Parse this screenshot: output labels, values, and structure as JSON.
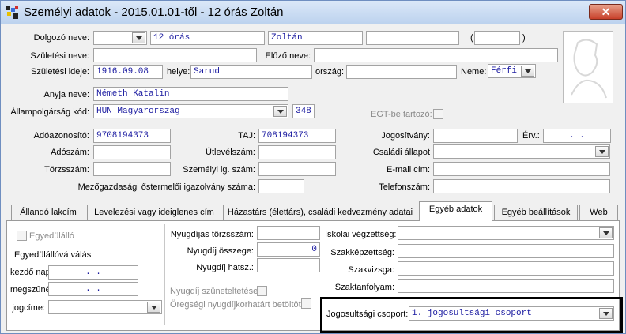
{
  "window": {
    "title": "Személyi adatok - 2015.01.01-től - 12 órás Zoltán",
    "close_label": "✕"
  },
  "person": {
    "name_label": "Dolgozó neve:",
    "name_title": "",
    "name_last": "12 órás",
    "name_first": "Zoltán",
    "name_extra": "",
    "name_paren_open": "(",
    "name_paren_value": "",
    "name_paren_close": ")",
    "birth_name_label": "Születési neve:",
    "birth_name": "",
    "prev_name_label": "Előző neve:",
    "prev_name": "",
    "birth_date_label": "Születési ideje:",
    "birth_date": "1916.09.08",
    "birth_place_label": "helye:",
    "birth_place": "Sarud",
    "country_label": "ország:",
    "country": "",
    "gender_label": "Neme:",
    "gender": "Férfi",
    "mother_label": "Anyja neve:",
    "mother": "Németh Katalin",
    "citizenship_label": "Állampolgárság kód:",
    "citizenship": "HUN Magyarország",
    "citizenship_code": "348",
    "egt_label": "EGT-be tartozó:"
  },
  "ids": {
    "tax_id_label": "Adóazonosító:",
    "tax_id": "9708194373",
    "taj_label": "TAJ:",
    "taj": "708194373",
    "license_label": "Jogosítvány:",
    "license": "",
    "valid_label": "Érv.:",
    "valid": ". .",
    "tax_no_label": "Adószám:",
    "tax_no": "",
    "passport_label": "Útlevélszám:",
    "passport": "",
    "family_label": "Családi állapot",
    "family": "",
    "registry_label": "Törzsszám:",
    "registry": "",
    "id_card_label": "Személyi ig. szám:",
    "id_card": "",
    "email_label": "E-mail cím:",
    "email": "",
    "farmer_label": "Mezőgazdasági őstermelői igazolvány száma:",
    "farmer": "",
    "phone_label": "Telefonszám:",
    "phone": ""
  },
  "tabs": [
    {
      "label": "Állandó lakcím"
    },
    {
      "label": "Levelezési vagy ideiglenes cím"
    },
    {
      "label": "Házastárs (élettárs), családi kedvezmény adatai"
    },
    {
      "label": "Egyéb adatok"
    },
    {
      "label": "Egyéb beállítások"
    },
    {
      "label": "Web"
    }
  ],
  "other": {
    "single_label": "Egyedülálló",
    "single_becoming_label": "Egyedülállóvá válás",
    "start_label": "kezdő napja:",
    "start": ". .",
    "end_label": "megszűnése:",
    "end": ". .",
    "title_label": "jogcíme:",
    "title": "",
    "pension_reg_label": "Nyugdíjas törzsszám:",
    "pension_reg": "",
    "pension_amount_label": "Nyugdíj összege:",
    "pension_amount": "0",
    "pension_auth_label": "Nyugdíj hatsz.:",
    "pension_auth": "",
    "pension_suspend_label": "Nyugdíj szüneteltetése",
    "pension_age_label": "Öregségi nyugdíjkorhatárt betöltött",
    "education_label": "Iskolai végzettség:",
    "education": "",
    "qualification_label": "Szakképzettség:",
    "qualification": "",
    "exam_label": "Szakvizsga:",
    "exam": "",
    "course_label": "Szaktanfolyam:",
    "course": "",
    "rights_label": "Jogosultsági csoport:",
    "rights": "1. jogosultsági csoport"
  }
}
